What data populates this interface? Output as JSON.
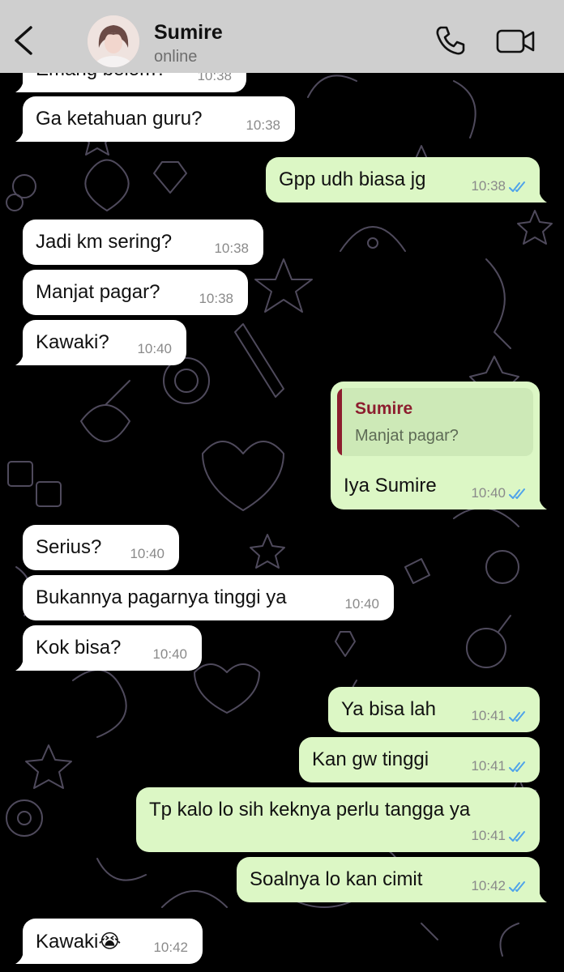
{
  "header": {
    "back_icon": "chevron-left-icon",
    "contact_name": "Sumire",
    "status": "online",
    "call_icon": "phone-icon",
    "video_icon": "video-camera-icon",
    "background_color": "#cfcfcf"
  },
  "colors": {
    "incoming_bubble": "#ffffff",
    "outgoing_bubble": "#dcf7c5",
    "read_ticks": "#4fa3ea",
    "quote_accent": "#8c1d2e"
  },
  "messages": [
    {
      "direction": "in",
      "text": "Emang belom?",
      "time": "10:38"
    },
    {
      "direction": "in",
      "text": "Ga ketahuan guru?",
      "time": "10:38"
    },
    {
      "direction": "out",
      "text": "Gpp udh biasa jg",
      "time": "10:38",
      "read": true
    },
    {
      "direction": "in",
      "text": "Jadi km sering?",
      "time": "10:38"
    },
    {
      "direction": "in",
      "text": "Manjat pagar?",
      "time": "10:38"
    },
    {
      "direction": "in",
      "text": "Kawaki?",
      "time": "10:40"
    },
    {
      "direction": "out",
      "text": "Iya Sumire",
      "time": "10:40",
      "read": true,
      "reply_to": {
        "name": "Sumire",
        "text": "Manjat pagar?"
      }
    },
    {
      "direction": "in",
      "text": "Serius?",
      "time": "10:40"
    },
    {
      "direction": "in",
      "text": "Bukannya pagarnya tinggi ya",
      "time": "10:40"
    },
    {
      "direction": "in",
      "text": "Kok bisa?",
      "time": "10:40"
    },
    {
      "direction": "out",
      "text": "Ya bisa lah",
      "time": "10:41",
      "read": true
    },
    {
      "direction": "out",
      "text": "Kan gw tinggi",
      "time": "10:41",
      "read": true
    },
    {
      "direction": "out",
      "text": "Tp kalo lo sih keknya perlu tangga ya",
      "time": "10:41",
      "read": true
    },
    {
      "direction": "out",
      "text": "Soalnya lo kan cimit",
      "time": "10:42",
      "read": true
    },
    {
      "direction": "in",
      "text": "Kawaki😭",
      "time": "10:42"
    }
  ]
}
